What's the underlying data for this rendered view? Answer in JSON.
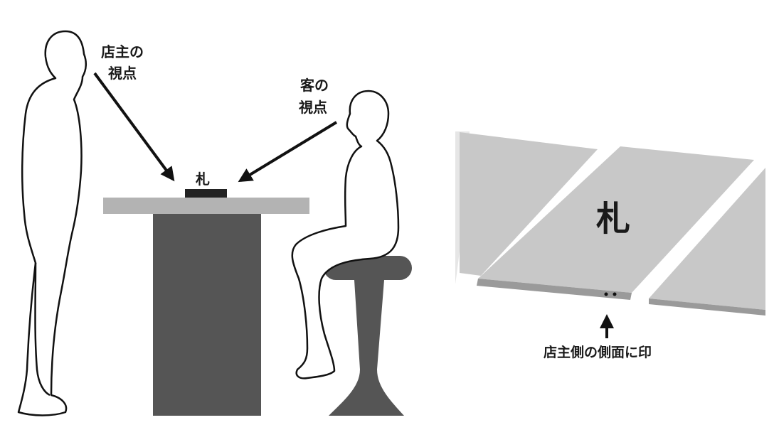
{
  "labels": {
    "owner_view_line1": "店主の",
    "owner_view_line2": "視点",
    "customer_view_line1": "客の",
    "customer_view_line2": "視点",
    "tile_small": "札",
    "tile_large": "札",
    "side_mark": "店主側の側面に印"
  },
  "colors": {
    "counter_body": "#555555",
    "counter_top": "#b3b3b3",
    "stool": "#555555",
    "tile_face": "#c8c8c8",
    "tile_side": "#9a9a9a",
    "outline": "#111111"
  }
}
